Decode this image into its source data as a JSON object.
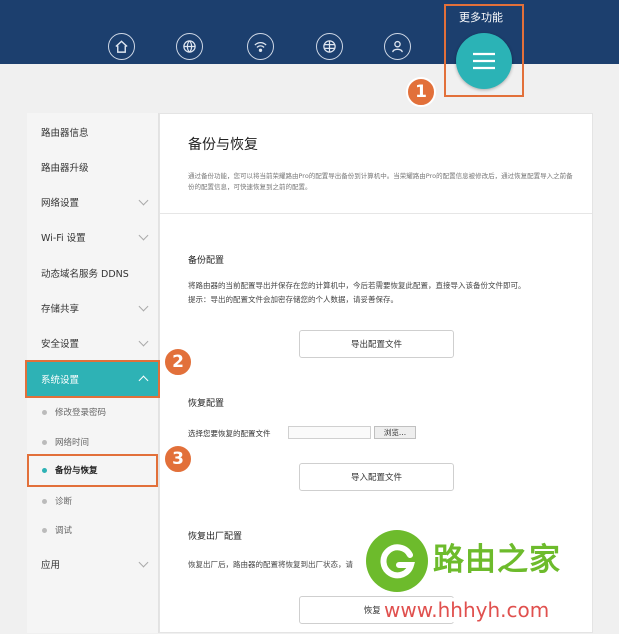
{
  "header": {
    "more_label": "更多功能",
    "nav_icons": [
      "home-icon",
      "globe-icon",
      "wifi-icon",
      "internet-globe-icon",
      "user-icon"
    ],
    "menu_icon": "hamburger-menu-icon",
    "bg_color": "#1c3f6e",
    "accent": "#2bb3b6"
  },
  "annotations": {
    "step1": "1",
    "step2": "2",
    "step3": "3",
    "color": "#e2703a"
  },
  "sidebar": {
    "items": [
      {
        "label": "路由器信息",
        "chevron": false
      },
      {
        "label": "路由器升级",
        "chevron": false
      },
      {
        "label": "网络设置",
        "chevron": true
      },
      {
        "label": "Wi-Fi 设置",
        "chevron": true
      },
      {
        "label": "动态域名服务 DDNS",
        "chevron": false
      },
      {
        "label": "存储共享",
        "chevron": true
      },
      {
        "label": "安全设置",
        "chevron": true
      },
      {
        "label": "系统设置",
        "chevron": true,
        "active": true
      }
    ],
    "subitems": [
      {
        "label": "修改登录密码"
      },
      {
        "label": "网络时间"
      },
      {
        "label": "备份与恢复",
        "current": true
      },
      {
        "label": "诊断"
      },
      {
        "label": "调试"
      }
    ],
    "bottom_item": {
      "label": "应用",
      "chevron": true
    }
  },
  "main": {
    "title": "备份与恢复",
    "description": "通过备份功能，您可以将当前荣耀路由Pro的配置导出备份到计算机中。当荣耀路由Pro的配置信息被修改后，通过恢复配置导入之前备份的配置信息，可快速恢复到之前的配置。",
    "backup": {
      "title": "备份配置",
      "desc_line1": "将路由器的当前配置导出并保存在您的计算机中，今后若需要恢复此配置，直接导入该备份文件即可。",
      "desc_line2": "提示：导出的配置文件会加密存储您的个人数据，请妥善保存。",
      "button": "导出配置文件"
    },
    "restore": {
      "title": "恢复配置",
      "file_label": "选择您要恢复的配置文件",
      "browse": "浏览...",
      "button": "导入配置文件"
    },
    "factory": {
      "title": "恢复出厂配置",
      "desc": "恢复出厂后，路由器的配置将恢复到出厂状态，请",
      "button": "恢复出"
    }
  },
  "watermark": {
    "title": "路由之家",
    "url": "www.hhhyh.com",
    "color": "#6dbb2c"
  }
}
